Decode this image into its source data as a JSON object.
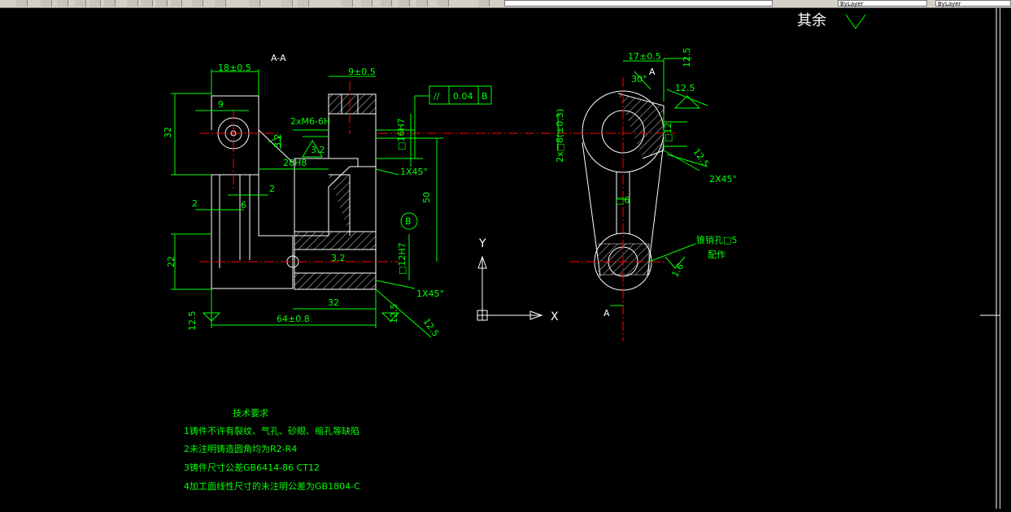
{
  "toolbar": {
    "combo1_value": "",
    "combo2_value": "ByLayer",
    "combo3_value": "ByLayer"
  },
  "drawing": {
    "section_label": "A-A",
    "surface_remainder_label": "其余",
    "dims": {
      "d18": "18±0.5",
      "d9a": "9",
      "d32v": "32",
      "d9b": "9±0.5",
      "tol_sym": "//",
      "tol_val": "0.04",
      "tol_datum": "B",
      "d2xM6": "2xM6-6H",
      "d16H7": "□16H7",
      "d3_2a": "3.2",
      "d3_2b": "3.2",
      "d28H8": "28H8",
      "d1x45a": "1X45°",
      "d2a": "2",
      "d2b": "2",
      "d6": "6",
      "d50": "50",
      "datumB": "B",
      "d22": "22",
      "d3_2c": "3.2",
      "d12H7": "□12H7",
      "d1x45b": "1X45°",
      "d32h": "32",
      "d12_5a": "12.5",
      "d64": "64±0.8",
      "d12_5b": "12.5",
      "d12_5c": "12.5",
      "d17": "17±0.5",
      "d12_5d": "12.5",
      "d30": "30°",
      "d12_5e": "12.5",
      "dA_top": "A",
      "d2x8": "2x□8(±0.3)",
      "d12": "□12",
      "d12_5f": "12.5",
      "d2x45": "2X45°",
      "d6b": "□6",
      "note_pin1": "锥销孔□5",
      "note_pin2": "配作",
      "d1_6": "1.6",
      "dA_bot": "A"
    },
    "ucs": {
      "y": "Y",
      "x": "X"
    },
    "notes": {
      "title": "技术要求",
      "line1": "1铸件不许有裂纹、气孔、砂眼、缩孔等缺陷",
      "line2": "2未注明铸造圆角均为R2-R4",
      "line3": "3铸件尺寸公差GB6414-86  CT12",
      "line4": "4加工面线性尺寸的未注明公差为GB1804-C"
    }
  },
  "colors": {
    "background": "#000000",
    "geometry": "#ffffff",
    "dimension": "#00ff00",
    "centerline": "#ff0000",
    "crosshair": "#ffffff"
  }
}
